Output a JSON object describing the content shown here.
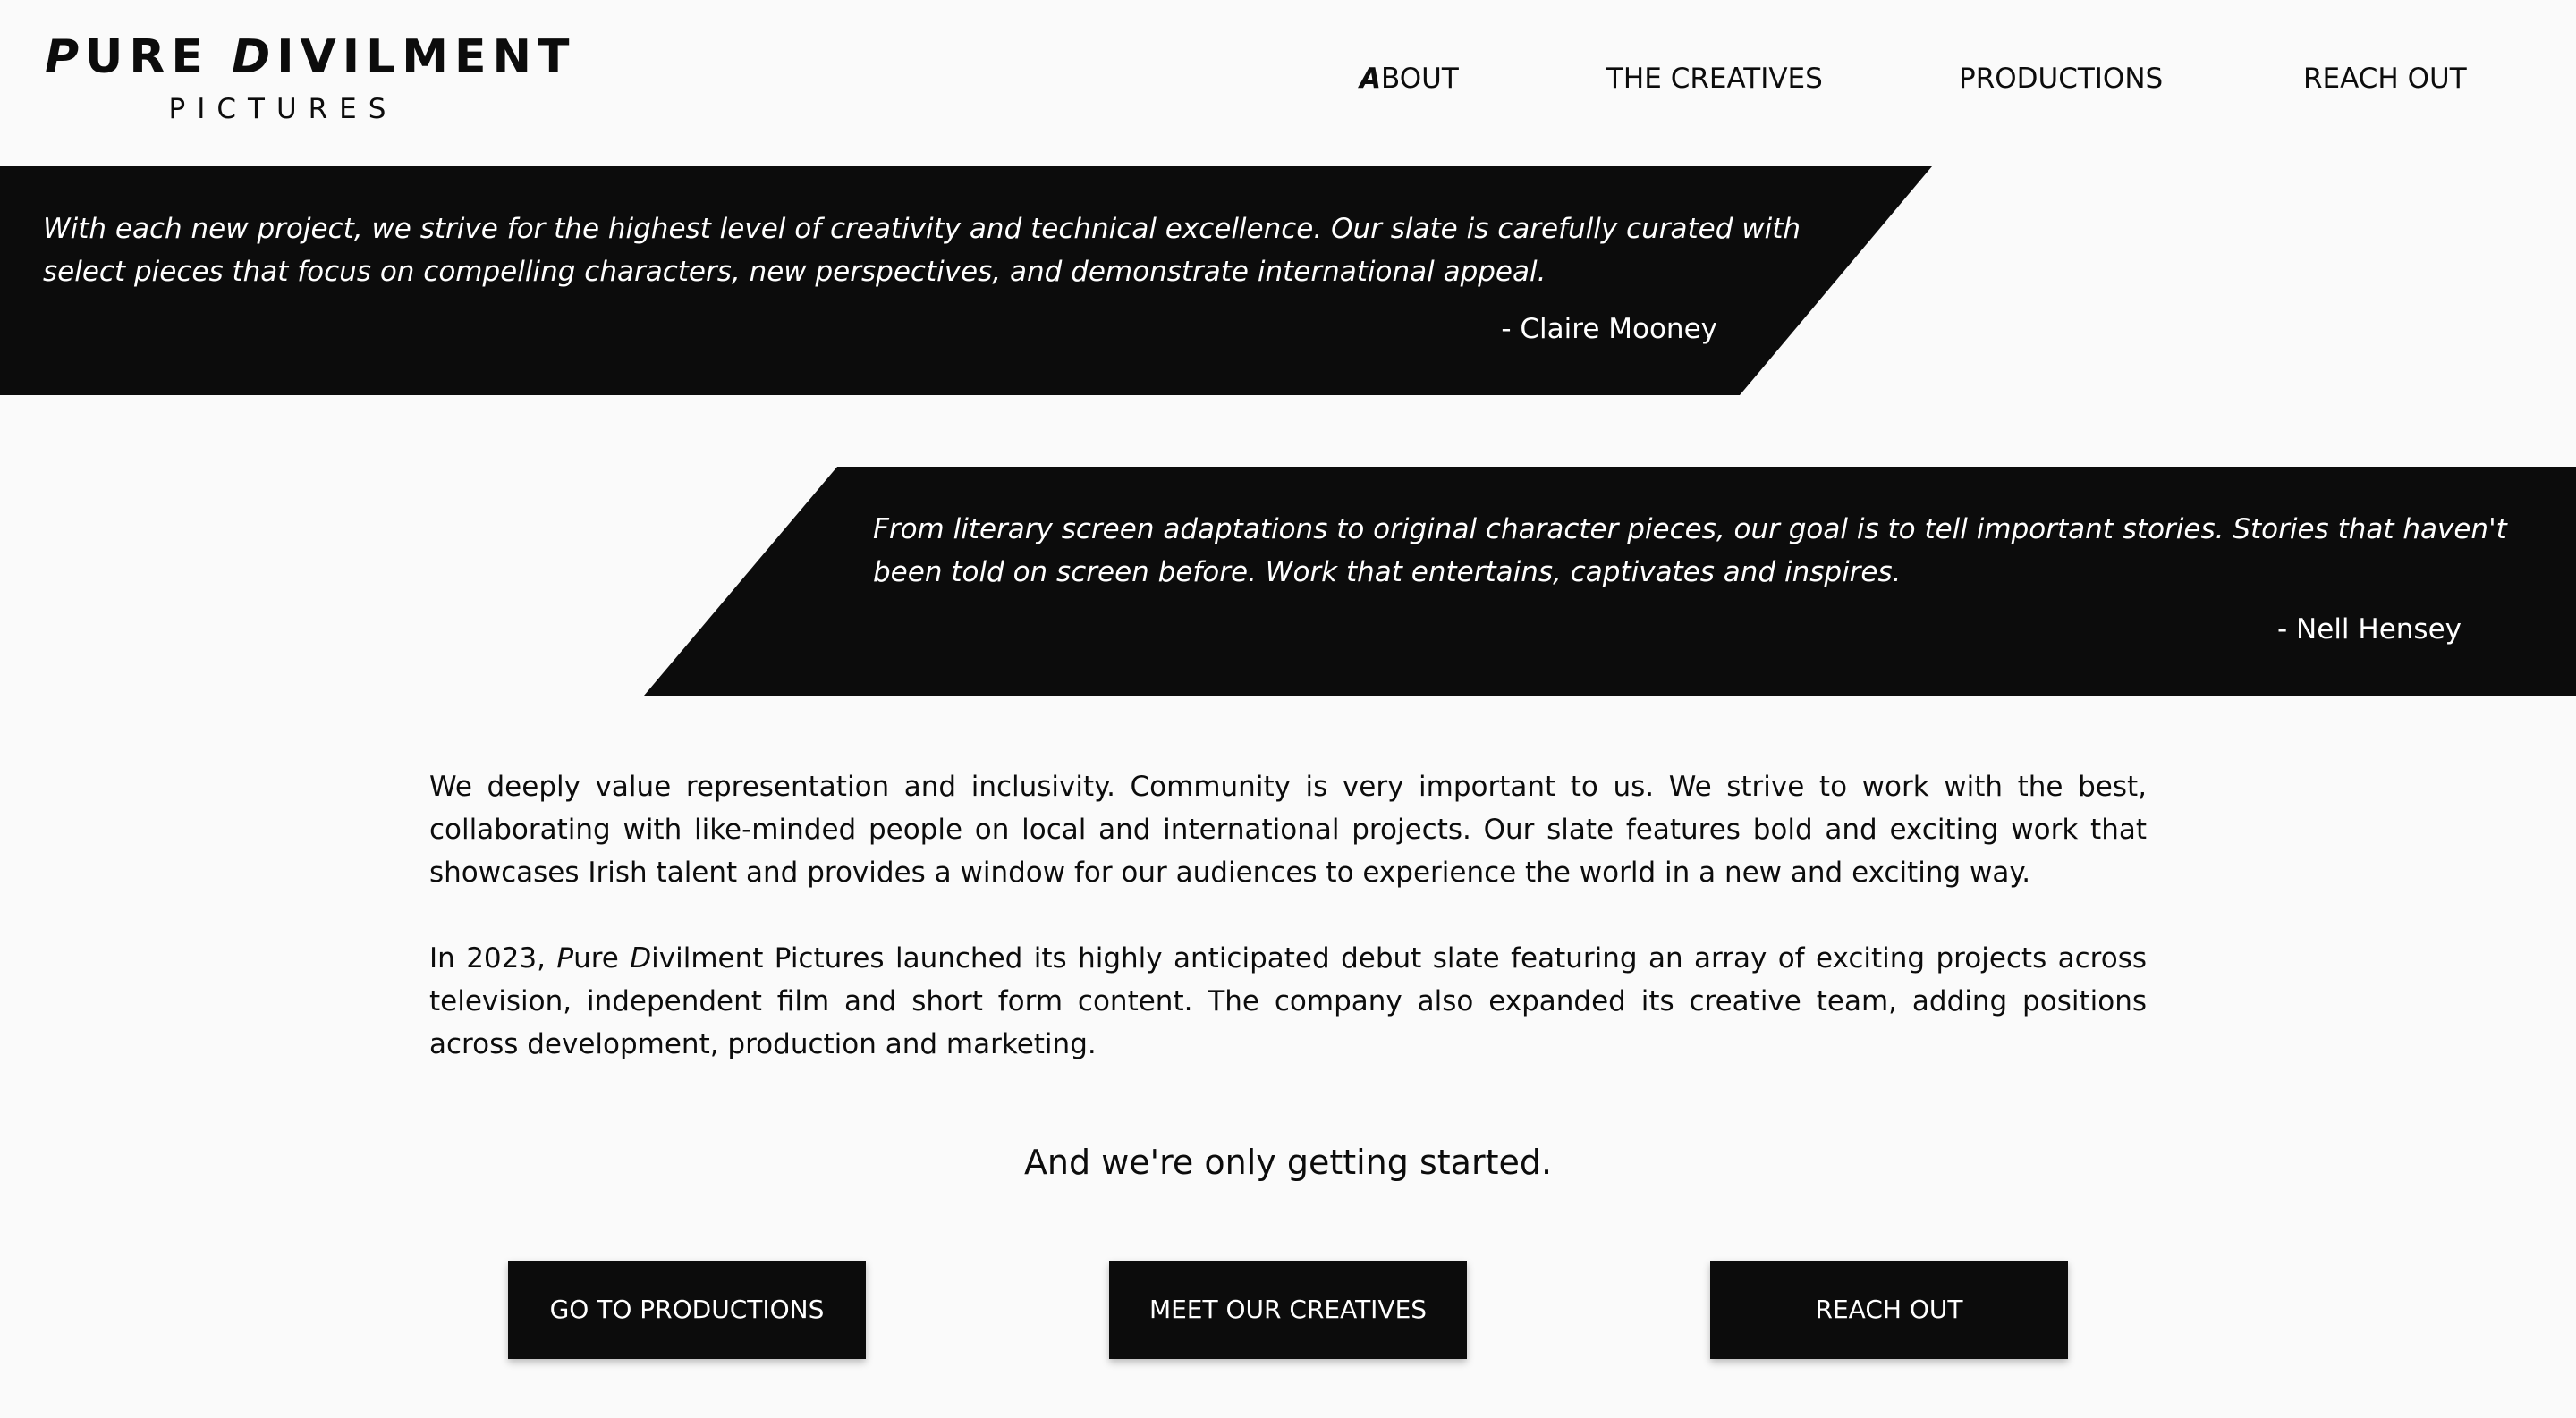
{
  "logo": {
    "word1_initial": "P",
    "word1_rest": "URE ",
    "word2_initial": "D",
    "word2_rest": "IVILMENT",
    "subtitle": "PICTURES"
  },
  "nav": {
    "about_initial": "A",
    "about_rest": "BOUT",
    "creatives": "THE CREATIVES",
    "productions": "PRODUCTIONS",
    "reach_out": "REACH OUT"
  },
  "quotes": [
    {
      "text": "With each new project, we strive for the highest level of creativity and technical excellence. Our slate is carefully curated with select pieces that focus on compelling characters, new perspectives, and demonstrate international appeal.",
      "author": "- Claire Mooney"
    },
    {
      "text": "From literary screen adaptations to original character pieces, our goal is to tell important stories. Stories that haven't been told on screen before. Work that entertains, captivates and inspires.",
      "author": "- Nell Hensey"
    }
  ],
  "body": {
    "paragraph1": "We deeply value representation and inclusivity. Community is very important to us. We strive to work with the best, collaborating with like-minded people on local and international projects. Our slate features bold and exciting work that showcases Irish talent and provides a window for our audiences to experience the world in a new and exciting way.",
    "paragraph2_prefix": "In 2023, ",
    "paragraph2_name1_initial": "P",
    "paragraph2_name1_rest": "ure ",
    "paragraph2_name2_initial": "D",
    "paragraph2_name2_rest": "ivilment Pictures",
    "paragraph2_suffix": " launched its highly anticipated debut slate featuring an array of exciting projects across television, independent film and short form content. The company also expanded its creative team, adding positions across development, production and marketing.",
    "tagline": "And we're only getting started."
  },
  "buttons": {
    "productions": "GO TO PRODUCTIONS",
    "creatives": "MEET OUR CREATIVES",
    "reach_out": "REACH OUT"
  },
  "colors": {
    "background": "#fafafa",
    "band": "#0c0c0c",
    "text": "#0c0c0c",
    "inverse_text": "#ffffff"
  }
}
